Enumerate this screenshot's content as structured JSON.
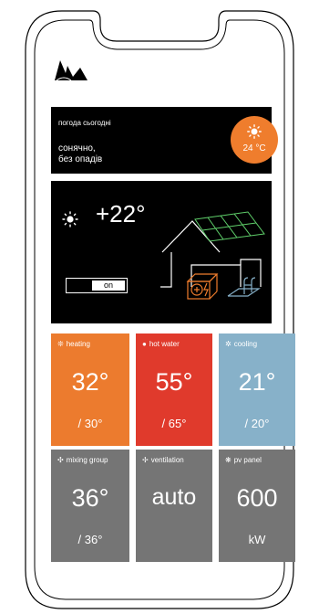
{
  "weather": {
    "caption": "погода сьогодні",
    "line1": "сонячно,",
    "line2": "без опадів",
    "temp": "24 °C"
  },
  "indoor": {
    "temp": "+22°",
    "toggle_label": "on"
  },
  "tiles": {
    "heating": {
      "label": "heating",
      "value": "32°",
      "target": "/ 30°"
    },
    "hot_water": {
      "label": "hot water",
      "value": "55°",
      "target": "/ 65°"
    },
    "cooling": {
      "label": "cooling",
      "value": "21°",
      "target": "/ 20°"
    },
    "mixing": {
      "label": "mixing group",
      "value": "36°",
      "target": "/ 36°"
    },
    "ventilation": {
      "label": "ventilation",
      "value": "auto"
    },
    "pv": {
      "label": "pv panel",
      "value": "600",
      "unit": "kW"
    }
  },
  "colors": {
    "heating": "#ec7b2e",
    "hot_water": "#e03a2c",
    "cooling": "#87b1c9",
    "neutral": "#757575"
  }
}
